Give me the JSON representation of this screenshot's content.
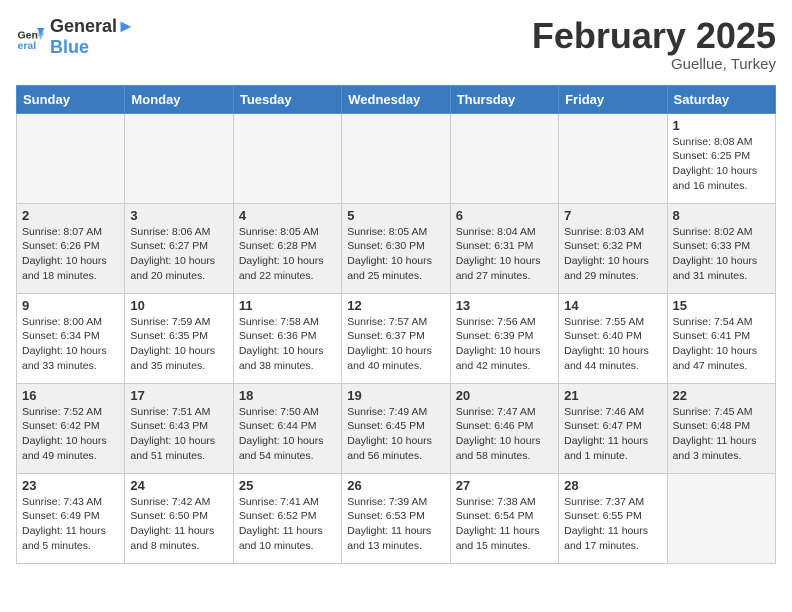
{
  "header": {
    "logo_general": "General",
    "logo_blue": "Blue",
    "month_year": "February 2025",
    "location": "Guellue, Turkey"
  },
  "days_of_week": [
    "Sunday",
    "Monday",
    "Tuesday",
    "Wednesday",
    "Thursday",
    "Friday",
    "Saturday"
  ],
  "weeks": [
    [
      {
        "day": "",
        "info": ""
      },
      {
        "day": "",
        "info": ""
      },
      {
        "day": "",
        "info": ""
      },
      {
        "day": "",
        "info": ""
      },
      {
        "day": "",
        "info": ""
      },
      {
        "day": "",
        "info": ""
      },
      {
        "day": "1",
        "info": "Sunrise: 8:08 AM\nSunset: 6:25 PM\nDaylight: 10 hours\nand 16 minutes."
      }
    ],
    [
      {
        "day": "2",
        "info": "Sunrise: 8:07 AM\nSunset: 6:26 PM\nDaylight: 10 hours\nand 18 minutes."
      },
      {
        "day": "3",
        "info": "Sunrise: 8:06 AM\nSunset: 6:27 PM\nDaylight: 10 hours\nand 20 minutes."
      },
      {
        "day": "4",
        "info": "Sunrise: 8:05 AM\nSunset: 6:28 PM\nDaylight: 10 hours\nand 22 minutes."
      },
      {
        "day": "5",
        "info": "Sunrise: 8:05 AM\nSunset: 6:30 PM\nDaylight: 10 hours\nand 25 minutes."
      },
      {
        "day": "6",
        "info": "Sunrise: 8:04 AM\nSunset: 6:31 PM\nDaylight: 10 hours\nand 27 minutes."
      },
      {
        "day": "7",
        "info": "Sunrise: 8:03 AM\nSunset: 6:32 PM\nDaylight: 10 hours\nand 29 minutes."
      },
      {
        "day": "8",
        "info": "Sunrise: 8:02 AM\nSunset: 6:33 PM\nDaylight: 10 hours\nand 31 minutes."
      }
    ],
    [
      {
        "day": "9",
        "info": "Sunrise: 8:00 AM\nSunset: 6:34 PM\nDaylight: 10 hours\nand 33 minutes."
      },
      {
        "day": "10",
        "info": "Sunrise: 7:59 AM\nSunset: 6:35 PM\nDaylight: 10 hours\nand 35 minutes."
      },
      {
        "day": "11",
        "info": "Sunrise: 7:58 AM\nSunset: 6:36 PM\nDaylight: 10 hours\nand 38 minutes."
      },
      {
        "day": "12",
        "info": "Sunrise: 7:57 AM\nSunset: 6:37 PM\nDaylight: 10 hours\nand 40 minutes."
      },
      {
        "day": "13",
        "info": "Sunrise: 7:56 AM\nSunset: 6:39 PM\nDaylight: 10 hours\nand 42 minutes."
      },
      {
        "day": "14",
        "info": "Sunrise: 7:55 AM\nSunset: 6:40 PM\nDaylight: 10 hours\nand 44 minutes."
      },
      {
        "day": "15",
        "info": "Sunrise: 7:54 AM\nSunset: 6:41 PM\nDaylight: 10 hours\nand 47 minutes."
      }
    ],
    [
      {
        "day": "16",
        "info": "Sunrise: 7:52 AM\nSunset: 6:42 PM\nDaylight: 10 hours\nand 49 minutes."
      },
      {
        "day": "17",
        "info": "Sunrise: 7:51 AM\nSunset: 6:43 PM\nDaylight: 10 hours\nand 51 minutes."
      },
      {
        "day": "18",
        "info": "Sunrise: 7:50 AM\nSunset: 6:44 PM\nDaylight: 10 hours\nand 54 minutes."
      },
      {
        "day": "19",
        "info": "Sunrise: 7:49 AM\nSunset: 6:45 PM\nDaylight: 10 hours\nand 56 minutes."
      },
      {
        "day": "20",
        "info": "Sunrise: 7:47 AM\nSunset: 6:46 PM\nDaylight: 10 hours\nand 58 minutes."
      },
      {
        "day": "21",
        "info": "Sunrise: 7:46 AM\nSunset: 6:47 PM\nDaylight: 11 hours\nand 1 minute."
      },
      {
        "day": "22",
        "info": "Sunrise: 7:45 AM\nSunset: 6:48 PM\nDaylight: 11 hours\nand 3 minutes."
      }
    ],
    [
      {
        "day": "23",
        "info": "Sunrise: 7:43 AM\nSunset: 6:49 PM\nDaylight: 11 hours\nand 5 minutes."
      },
      {
        "day": "24",
        "info": "Sunrise: 7:42 AM\nSunset: 6:50 PM\nDaylight: 11 hours\nand 8 minutes."
      },
      {
        "day": "25",
        "info": "Sunrise: 7:41 AM\nSunset: 6:52 PM\nDaylight: 11 hours\nand 10 minutes."
      },
      {
        "day": "26",
        "info": "Sunrise: 7:39 AM\nSunset: 6:53 PM\nDaylight: 11 hours\nand 13 minutes."
      },
      {
        "day": "27",
        "info": "Sunrise: 7:38 AM\nSunset: 6:54 PM\nDaylight: 11 hours\nand 15 minutes."
      },
      {
        "day": "28",
        "info": "Sunrise: 7:37 AM\nSunset: 6:55 PM\nDaylight: 11 hours\nand 17 minutes."
      },
      {
        "day": "",
        "info": ""
      }
    ]
  ]
}
